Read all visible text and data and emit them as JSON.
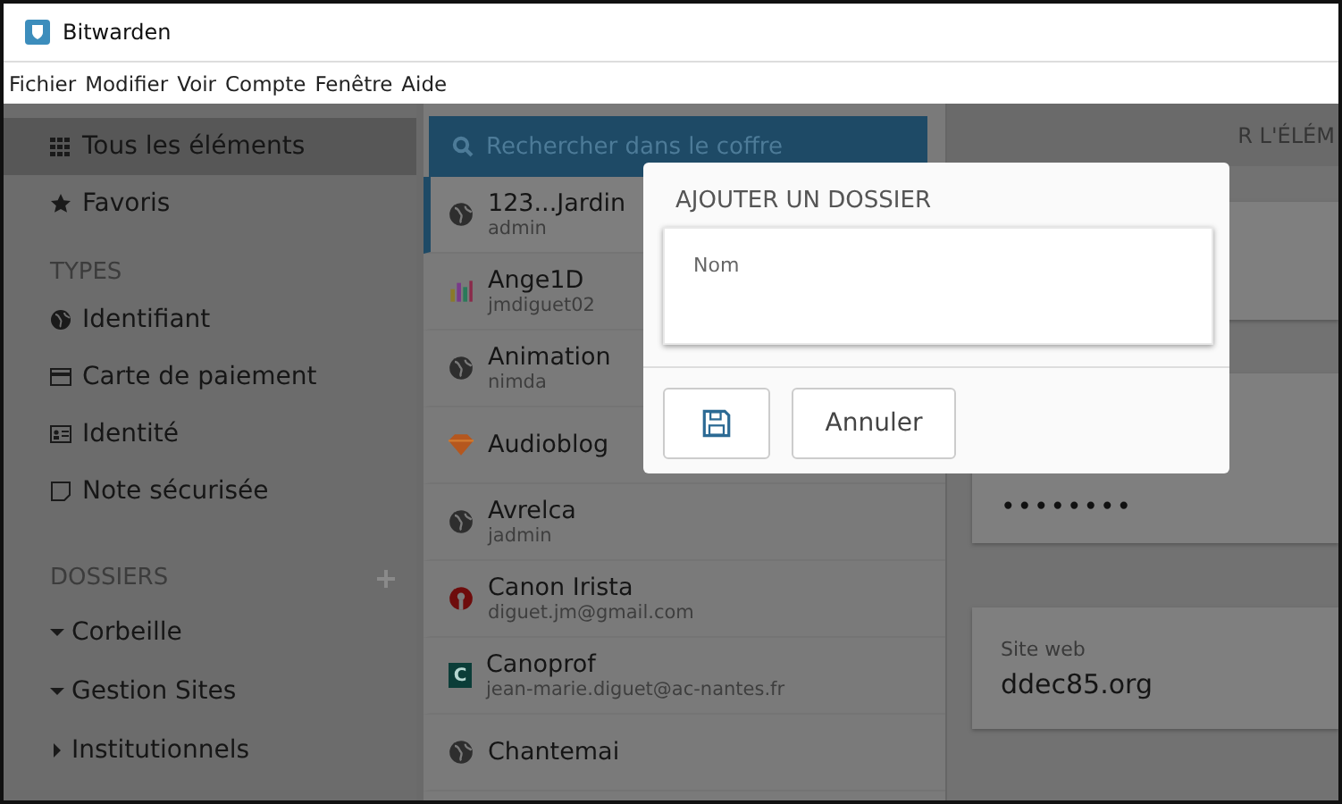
{
  "window": {
    "title": "Bitwarden"
  },
  "menu": [
    "Fichier",
    "Modifier",
    "Voir",
    "Compte",
    "Fenêtre",
    "Aide"
  ],
  "sidebar": {
    "filters": [
      {
        "label": "Tous les éléments",
        "kind": "grid",
        "selected": true
      },
      {
        "label": "Favoris",
        "kind": "star",
        "selected": false
      }
    ],
    "types_heading": "TYPES",
    "types": [
      {
        "label": "Identifiant",
        "kind": "globe",
        "selected": false
      },
      {
        "label": "Carte de paiement",
        "kind": "card",
        "selected": false
      },
      {
        "label": "Identité",
        "kind": "id",
        "selected": false
      },
      {
        "label": "Note sécurisée",
        "kind": "note",
        "selected": false
      }
    ],
    "folders_heading": "DOSSIERS",
    "folders": [
      {
        "label": "Corbeille",
        "expanded": true
      },
      {
        "label": "Gestion Sites",
        "expanded": true
      },
      {
        "label": "Institutionnels",
        "expanded": false
      }
    ]
  },
  "search": {
    "placeholder": "Rechercher dans le coffre"
  },
  "items": [
    {
      "name": "123...Jardin",
      "subtitle": "admin",
      "kind": "globe",
      "selected": true
    },
    {
      "name": "Ange1D",
      "subtitle": "jmdiguet02",
      "kind": "chart",
      "selected": false
    },
    {
      "name": "Animation",
      "subtitle": "nimda",
      "kind": "globe",
      "selected": false
    },
    {
      "name": "Audioblog",
      "kind": "gem",
      "selected": false
    },
    {
      "name": "Avrelca",
      "subtitle": "jadmin",
      "kind": "globe",
      "selected": false
    },
    {
      "name": "Canon Irista",
      "subtitle": "diguet.jm@gmail.com",
      "kind": "logo",
      "selected": false
    },
    {
      "name": "Canoprof",
      "subtitle": "jean-marie.diguet@ac-nantes.fr",
      "kind": "letter",
      "badge": "C",
      "selected": false
    },
    {
      "name": "Chantemai",
      "kind": "globe",
      "selected": false
    }
  ],
  "details": {
    "header": "R L'ÉLÉM",
    "password": "••••••••",
    "site_label": "Site web",
    "site": "ddec85.org"
  },
  "dialog": {
    "title": "AJOUTER UN DOSSIER",
    "field_label": "Nom",
    "cancel": "Annuler"
  }
}
